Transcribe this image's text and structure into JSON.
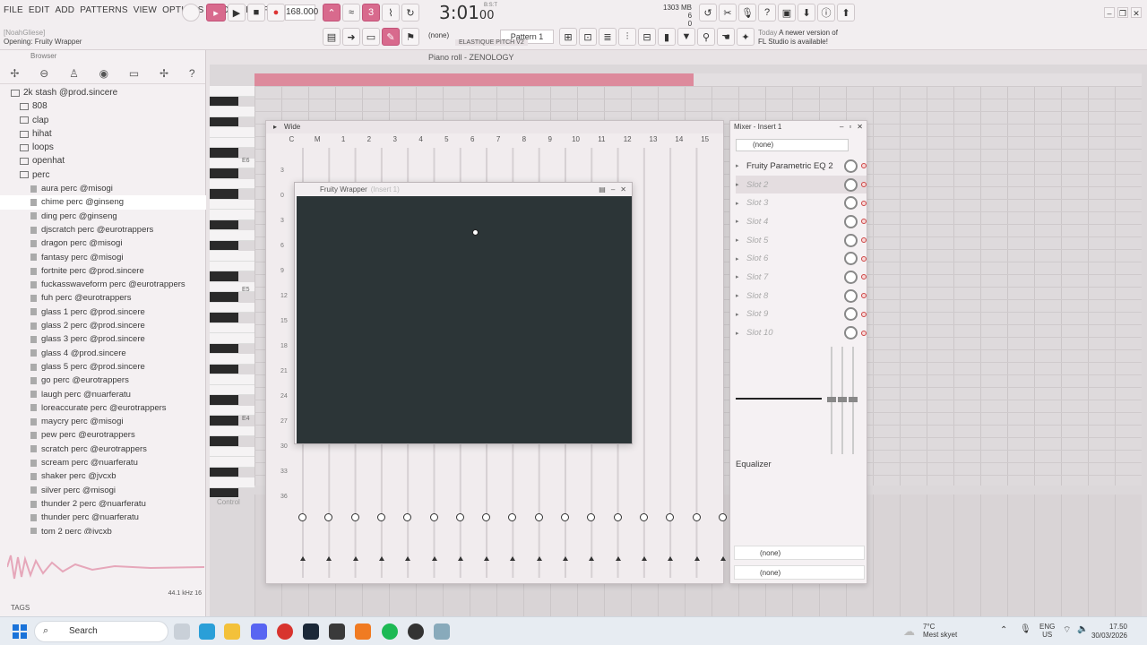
{
  "menu": [
    "FILE",
    "EDIT",
    "ADD",
    "PATTERNS",
    "VIEW",
    "OPTIONS",
    "TOOLS",
    "HELP"
  ],
  "user_hint": "[NoahGliese]",
  "hint_text": "Opening: Fruity Wrapper",
  "toolbar": {
    "bpm": "168.000",
    "time": "3:01",
    "time_ticks": "00",
    "time_unit": "B:S:T",
    "pattern": "Pattern 1",
    "none_select": "(none)",
    "elastique": "ELASTIQUE PITCH V2",
    "mem_value": "1303 MB",
    "mem_cpu": "6",
    "mem_poly": "0"
  },
  "news": {
    "day": "Today",
    "line1": "A newer version of",
    "line2": "FL Studio is available!"
  },
  "browser": {
    "title": "Browser",
    "root": "2k stash @prod.sincere",
    "folders": [
      "808",
      "clap",
      "hihat",
      "loops",
      "openhat",
      "perc"
    ],
    "files": [
      "aura perc @misogi",
      "chime perc @ginseng",
      "ding perc @ginseng",
      "djscratch perc @eurotrappers",
      "dragon perc @misogi",
      "fantasy perc @misogi",
      "fortnite perc @prod.sincere",
      "fuckasswaveform perc @eurotrappers",
      "fuh perc @eurotrappers",
      "glass 1 perc @prod.sincere",
      "glass 2 perc @prod.sincere",
      "glass 3 perc @prod.sincere",
      "glass 4 @prod.sincere",
      "glass 5 perc @prod.sincere",
      "go perc @eurotrappers",
      "laugh perc @nuarferatu",
      "loreaccurate perc @eurotrappers",
      "maycry perc @misogi",
      "pew perc @eurotrappers",
      "scratch perc @eurotrappers",
      "scream perc @nuarferatu",
      "shaker perc @jvcxb",
      "silver perc @misogi",
      "thunder 2 perc @nuarferatu",
      "thunder perc @nuarferatu",
      "tom 2 perc @jvcxb",
      "tom perc @jvcxb",
      "wind perc @nuarferatu"
    ],
    "selected_index": 1,
    "sample_info": "44.1 kHz 16",
    "tags": "TAGS"
  },
  "piano_roll": {
    "title": "Piano roll - ZENOLOGY",
    "octaves": [
      "E6",
      "E5",
      "E4"
    ],
    "control_label": "Control"
  },
  "channel_rack": {
    "mode": "Wide",
    "columns": [
      "C",
      "M",
      "1",
      "2",
      "3",
      "4",
      "5",
      "6",
      "7",
      "8",
      "9",
      "10",
      "11",
      "12",
      "13",
      "14",
      "15"
    ],
    "row_labels": [
      "3",
      "0",
      "3",
      "6",
      "9",
      "12",
      "15",
      "18",
      "21",
      "24",
      "27",
      "30",
      "33",
      "36"
    ]
  },
  "wrapper": {
    "title": "Fruity Wrapper",
    "sub": "(Insert 1)"
  },
  "mixer": {
    "title": "Mixer - Insert 1",
    "input": "(none)",
    "slots": [
      {
        "label": "Fruity Parametric EQ 2",
        "empty": false
      },
      {
        "label": "Slot 2",
        "empty": true,
        "active": true
      },
      {
        "label": "Slot 3",
        "empty": true
      },
      {
        "label": "Slot 4",
        "empty": true
      },
      {
        "label": "Slot 5",
        "empty": true
      },
      {
        "label": "Slot 6",
        "empty": true
      },
      {
        "label": "Slot 7",
        "empty": true
      },
      {
        "label": "Slot 8",
        "empty": true
      },
      {
        "label": "Slot 9",
        "empty": true
      },
      {
        "label": "Slot 10",
        "empty": true
      }
    ],
    "eq_label": "Equalizer",
    "out1": "(none)",
    "out2": "(none)"
  },
  "taskbar": {
    "search": "Search",
    "weather_temp": "7°C",
    "weather_desc": "Mest skyet",
    "lang": "ENG",
    "region": "US",
    "time": "17.50",
    "date": "30/03/2026"
  },
  "colors": {
    "accent": "#d86a8d",
    "ruler": "#dd8a9c",
    "plugin_bg": "#2c3537"
  }
}
